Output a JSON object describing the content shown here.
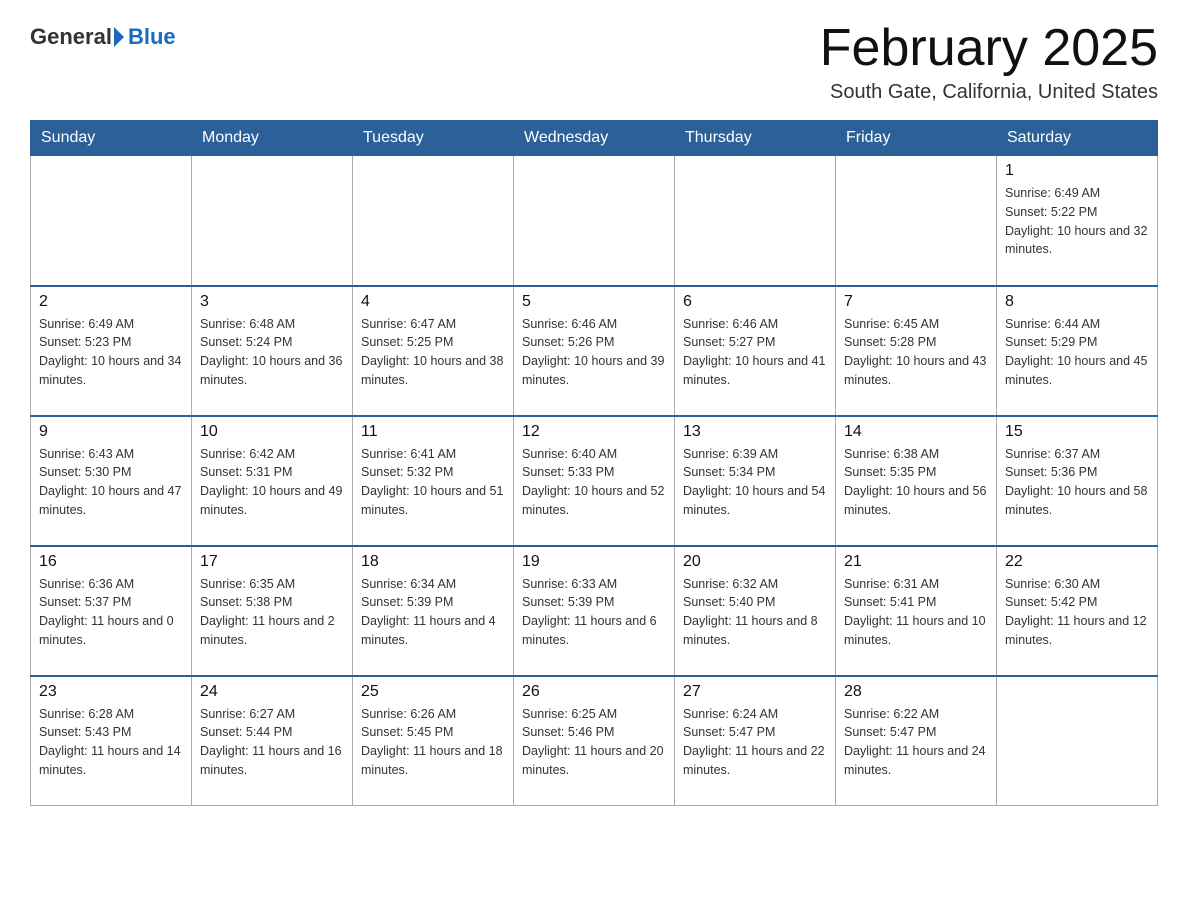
{
  "header": {
    "logo_general": "General",
    "logo_blue": "Blue",
    "month_title": "February 2025",
    "location": "South Gate, California, United States"
  },
  "weekdays": [
    "Sunday",
    "Monday",
    "Tuesday",
    "Wednesday",
    "Thursday",
    "Friday",
    "Saturday"
  ],
  "weeks": [
    [
      {
        "day": "",
        "sunrise": "",
        "sunset": "",
        "daylight": ""
      },
      {
        "day": "",
        "sunrise": "",
        "sunset": "",
        "daylight": ""
      },
      {
        "day": "",
        "sunrise": "",
        "sunset": "",
        "daylight": ""
      },
      {
        "day": "",
        "sunrise": "",
        "sunset": "",
        "daylight": ""
      },
      {
        "day": "",
        "sunrise": "",
        "sunset": "",
        "daylight": ""
      },
      {
        "day": "",
        "sunrise": "",
        "sunset": "",
        "daylight": ""
      },
      {
        "day": "1",
        "sunrise": "Sunrise: 6:49 AM",
        "sunset": "Sunset: 5:22 PM",
        "daylight": "Daylight: 10 hours and 32 minutes."
      }
    ],
    [
      {
        "day": "2",
        "sunrise": "Sunrise: 6:49 AM",
        "sunset": "Sunset: 5:23 PM",
        "daylight": "Daylight: 10 hours and 34 minutes."
      },
      {
        "day": "3",
        "sunrise": "Sunrise: 6:48 AM",
        "sunset": "Sunset: 5:24 PM",
        "daylight": "Daylight: 10 hours and 36 minutes."
      },
      {
        "day": "4",
        "sunrise": "Sunrise: 6:47 AM",
        "sunset": "Sunset: 5:25 PM",
        "daylight": "Daylight: 10 hours and 38 minutes."
      },
      {
        "day": "5",
        "sunrise": "Sunrise: 6:46 AM",
        "sunset": "Sunset: 5:26 PM",
        "daylight": "Daylight: 10 hours and 39 minutes."
      },
      {
        "day": "6",
        "sunrise": "Sunrise: 6:46 AM",
        "sunset": "Sunset: 5:27 PM",
        "daylight": "Daylight: 10 hours and 41 minutes."
      },
      {
        "day": "7",
        "sunrise": "Sunrise: 6:45 AM",
        "sunset": "Sunset: 5:28 PM",
        "daylight": "Daylight: 10 hours and 43 minutes."
      },
      {
        "day": "8",
        "sunrise": "Sunrise: 6:44 AM",
        "sunset": "Sunset: 5:29 PM",
        "daylight": "Daylight: 10 hours and 45 minutes."
      }
    ],
    [
      {
        "day": "9",
        "sunrise": "Sunrise: 6:43 AM",
        "sunset": "Sunset: 5:30 PM",
        "daylight": "Daylight: 10 hours and 47 minutes."
      },
      {
        "day": "10",
        "sunrise": "Sunrise: 6:42 AM",
        "sunset": "Sunset: 5:31 PM",
        "daylight": "Daylight: 10 hours and 49 minutes."
      },
      {
        "day": "11",
        "sunrise": "Sunrise: 6:41 AM",
        "sunset": "Sunset: 5:32 PM",
        "daylight": "Daylight: 10 hours and 51 minutes."
      },
      {
        "day": "12",
        "sunrise": "Sunrise: 6:40 AM",
        "sunset": "Sunset: 5:33 PM",
        "daylight": "Daylight: 10 hours and 52 minutes."
      },
      {
        "day": "13",
        "sunrise": "Sunrise: 6:39 AM",
        "sunset": "Sunset: 5:34 PM",
        "daylight": "Daylight: 10 hours and 54 minutes."
      },
      {
        "day": "14",
        "sunrise": "Sunrise: 6:38 AM",
        "sunset": "Sunset: 5:35 PM",
        "daylight": "Daylight: 10 hours and 56 minutes."
      },
      {
        "day": "15",
        "sunrise": "Sunrise: 6:37 AM",
        "sunset": "Sunset: 5:36 PM",
        "daylight": "Daylight: 10 hours and 58 minutes."
      }
    ],
    [
      {
        "day": "16",
        "sunrise": "Sunrise: 6:36 AM",
        "sunset": "Sunset: 5:37 PM",
        "daylight": "Daylight: 11 hours and 0 minutes."
      },
      {
        "day": "17",
        "sunrise": "Sunrise: 6:35 AM",
        "sunset": "Sunset: 5:38 PM",
        "daylight": "Daylight: 11 hours and 2 minutes."
      },
      {
        "day": "18",
        "sunrise": "Sunrise: 6:34 AM",
        "sunset": "Sunset: 5:39 PM",
        "daylight": "Daylight: 11 hours and 4 minutes."
      },
      {
        "day": "19",
        "sunrise": "Sunrise: 6:33 AM",
        "sunset": "Sunset: 5:39 PM",
        "daylight": "Daylight: 11 hours and 6 minutes."
      },
      {
        "day": "20",
        "sunrise": "Sunrise: 6:32 AM",
        "sunset": "Sunset: 5:40 PM",
        "daylight": "Daylight: 11 hours and 8 minutes."
      },
      {
        "day": "21",
        "sunrise": "Sunrise: 6:31 AM",
        "sunset": "Sunset: 5:41 PM",
        "daylight": "Daylight: 11 hours and 10 minutes."
      },
      {
        "day": "22",
        "sunrise": "Sunrise: 6:30 AM",
        "sunset": "Sunset: 5:42 PM",
        "daylight": "Daylight: 11 hours and 12 minutes."
      }
    ],
    [
      {
        "day": "23",
        "sunrise": "Sunrise: 6:28 AM",
        "sunset": "Sunset: 5:43 PM",
        "daylight": "Daylight: 11 hours and 14 minutes."
      },
      {
        "day": "24",
        "sunrise": "Sunrise: 6:27 AM",
        "sunset": "Sunset: 5:44 PM",
        "daylight": "Daylight: 11 hours and 16 minutes."
      },
      {
        "day": "25",
        "sunrise": "Sunrise: 6:26 AM",
        "sunset": "Sunset: 5:45 PM",
        "daylight": "Daylight: 11 hours and 18 minutes."
      },
      {
        "day": "26",
        "sunrise": "Sunrise: 6:25 AM",
        "sunset": "Sunset: 5:46 PM",
        "daylight": "Daylight: 11 hours and 20 minutes."
      },
      {
        "day": "27",
        "sunrise": "Sunrise: 6:24 AM",
        "sunset": "Sunset: 5:47 PM",
        "daylight": "Daylight: 11 hours and 22 minutes."
      },
      {
        "day": "28",
        "sunrise": "Sunrise: 6:22 AM",
        "sunset": "Sunset: 5:47 PM",
        "daylight": "Daylight: 11 hours and 24 minutes."
      },
      {
        "day": "",
        "sunrise": "",
        "sunset": "",
        "daylight": ""
      }
    ]
  ]
}
